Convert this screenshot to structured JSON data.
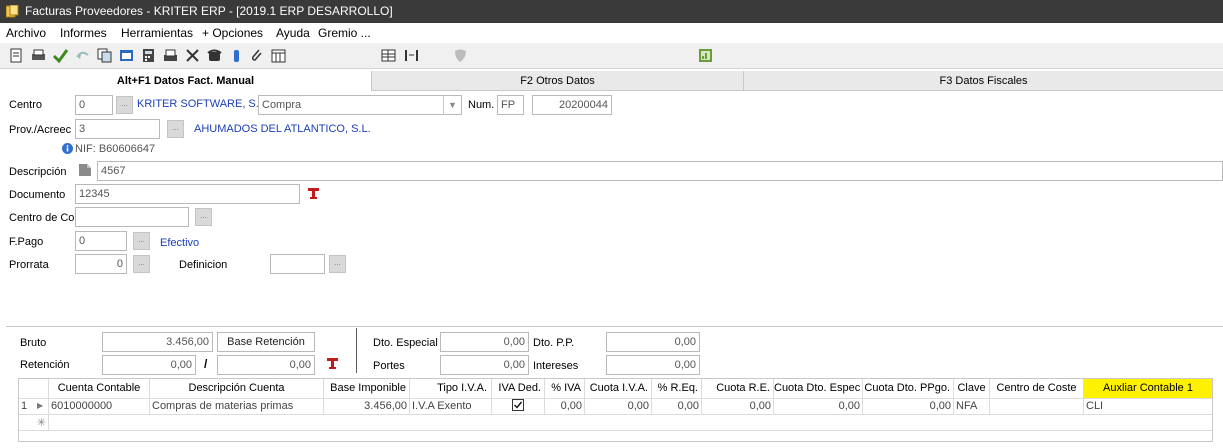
{
  "window": {
    "title": "Facturas Proveedores - KRITER ERP - [2019.1 ERP DESARROLLO]"
  },
  "menu": [
    "Archivo",
    "Informes",
    "Herramientas",
    "+ Opciones",
    "Ayuda",
    "Gremio ..."
  ],
  "tabs": [
    "Alt+F1 Datos Fact. Manual",
    "F2 Otros Datos",
    "F3 Datos Fiscales"
  ],
  "form": {
    "centro": {
      "label": "Centro",
      "value": "0",
      "name": "KRITER SOFTWARE, S.I",
      "tipo": "Compra"
    },
    "num": {
      "label": "Num.",
      "serie": "FP",
      "value": "20200044"
    },
    "prov": {
      "label": "Prov./Acreec",
      "value": "3",
      "name": "AHUMADOS DEL ATLANTICO, S.L.",
      "nif": "NIF:  B60606647"
    },
    "descripcion": {
      "label": "Descripción",
      "value": "4567"
    },
    "documento": {
      "label": "Documento",
      "value": "12345"
    },
    "centro_coste": {
      "label": "Centro de Co",
      "value": ""
    },
    "fpago": {
      "label": "F.Pago",
      "value": "0",
      "name": "Efectivo"
    },
    "prorrata": {
      "label": "Prorrata",
      "value": "0",
      "definicion_label": "Definicion",
      "definicion_value": ""
    }
  },
  "totals": {
    "bruto_label": "Bruto",
    "bruto": "3.456,00",
    "base_retencion_label": "Base Retención",
    "retencion_label": "Retención",
    "retencion_pct": "0,00",
    "slash": "/",
    "retencion": "0,00",
    "dto_especial_label": "Dto. Especial",
    "dto_especial": "0,00",
    "dto_pp_label": "Dto. P.P.",
    "dto_pp": "0,00",
    "portes_label": "Portes",
    "portes": "0,00",
    "intereses_label": "Intereses",
    "intereses": "0,00"
  },
  "grid": {
    "columns": [
      "Cuenta Contable",
      "Descripción Cuenta",
      "Base Imponible",
      "Tipo I.V.A.",
      "IVA Ded.",
      "% IVA",
      "Cuota I.V.A.",
      "% R.Eq.",
      "Cuota R.E.",
      "Cuota Dto. Espec",
      "Cuota Dto. PPgo.",
      "Clave",
      "Centro de Coste",
      "Auxliar Contable 1"
    ],
    "rows": [
      {
        "index": "1",
        "cells": [
          "6010000000",
          "Compras de materias primas",
          "3.456,00",
          "I.V.A Exento",
          "",
          "0,00",
          "0,00",
          "0,00",
          "0,00",
          "0,00",
          "0,00",
          "NFA",
          "",
          "CLI"
        ],
        "iva_ded_checked": true
      }
    ],
    "new_row_marker": "✳"
  },
  "colors": {
    "highlight": "#fff200",
    "link_blue": "#1b3fb5",
    "titlebar": "#3a3a3a"
  }
}
